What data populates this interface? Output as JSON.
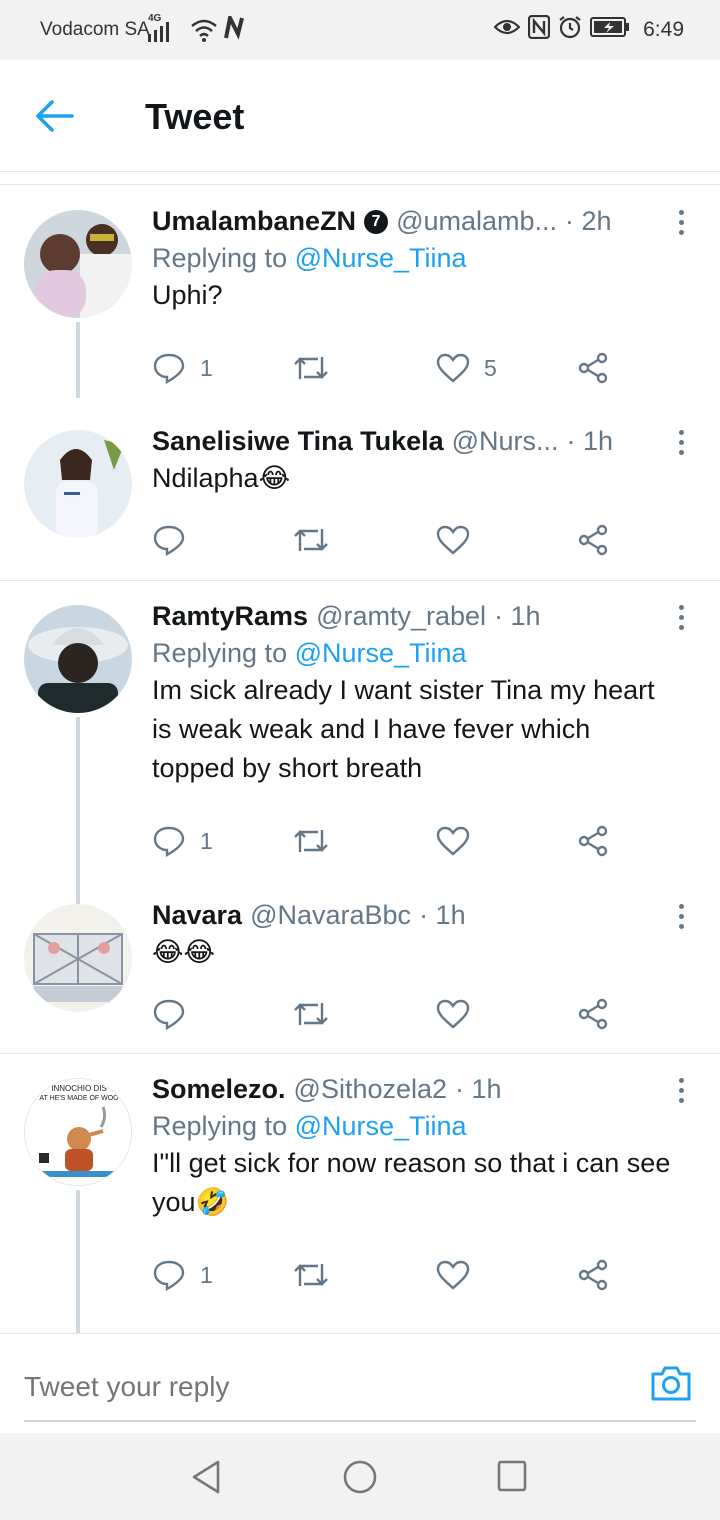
{
  "status": {
    "carrier": "Vodacom SA",
    "network": "4G",
    "time": "6:49"
  },
  "header": {
    "title": "Tweet"
  },
  "tweets": [
    {
      "name": "UmalambaneZN",
      "verified_badge": "7",
      "handle": "@umalamb...",
      "time": "· 2h",
      "replying_label": "Replying to",
      "replying_to": "@Nurse_Tiina",
      "text": "Uphi?",
      "reply_count": "1",
      "retweet_count": "",
      "like_count": "5",
      "avatar_colors": [
        "#e8d8e8",
        "#6b4b3e"
      ]
    },
    {
      "name": "Sanelisiwe Tina Tukela",
      "handle": "@Nurs...",
      "time": "· 1h",
      "text": "Ndilapha😂",
      "reply_count": "",
      "retweet_count": "",
      "like_count": "",
      "avatar_colors": [
        "#dfe7ef",
        "#5a3a2e"
      ]
    },
    {
      "name": "RamtyRams",
      "handle": "@ramty_rabel",
      "time": "· 1h",
      "replying_label": "Replying to",
      "replying_to": "@Nurse_Tiina",
      "text": "Im sick already I want sister Tina my heart is weak weak and I have fever which topped by short breath",
      "reply_count": "1",
      "retweet_count": "",
      "like_count": "",
      "avatar_colors": [
        "#c8d4dc",
        "#2d2a28"
      ]
    },
    {
      "name": "Navara",
      "handle": "@NavaraBbc",
      "time": "· 1h",
      "text": "😂😂",
      "reply_count": "",
      "retweet_count": "",
      "like_count": "",
      "avatar_colors": [
        "#f2f0ea",
        "#9aa6b8"
      ]
    },
    {
      "name": "Somelezo.",
      "handle": "@Sithozela2",
      "time": "· 1h",
      "replying_label": "Replying to",
      "replying_to": "@Nurse_Tiina",
      "text": "I\"ll get sick for now reason so that i can see you🤣",
      "reply_count": "1",
      "retweet_count": "",
      "like_count": "",
      "avatar_caption_1": "INNOCHIO DIS",
      "avatar_caption_2": "AT HE'S MADE OF WOO",
      "avatar_colors": [
        "#ffffff",
        "#c0522a"
      ]
    }
  ],
  "reply_bar": {
    "placeholder": "Tweet your reply"
  },
  "colors": {
    "accent": "#1da1f2",
    "secondary_text": "#657786",
    "divider": "#e1e8ed"
  },
  "icons": {
    "back": "arrow-left-icon",
    "more": "more-vertical-icon",
    "reply": "comment-icon",
    "retweet": "retweet-icon",
    "like": "heart-icon",
    "share": "share-icon",
    "camera": "camera-icon",
    "nav_back": "triangle-back-icon",
    "nav_home": "circle-home-icon",
    "nav_recents": "square-recents-icon"
  }
}
